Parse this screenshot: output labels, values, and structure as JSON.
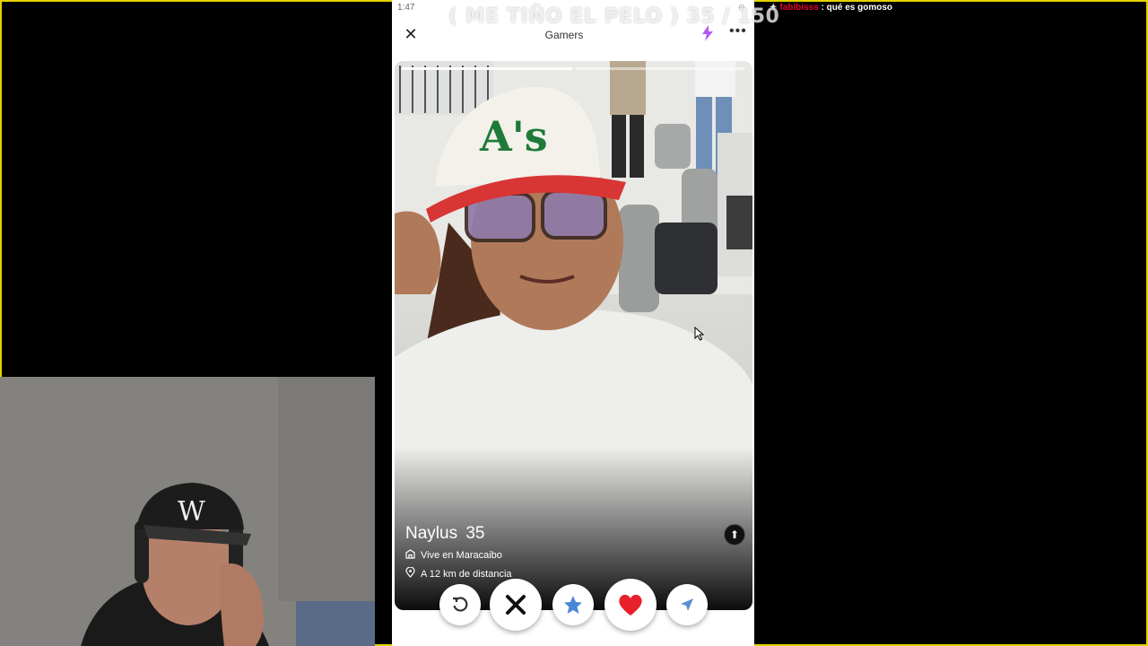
{
  "status": {
    "time": "1:47"
  },
  "app": {
    "title": "Gamers",
    "close_icon": "close-icon",
    "boost_icon": "lightning-icon",
    "more_icon": "more-icon"
  },
  "profile": {
    "name": "Naylus",
    "age": "35",
    "lives_in": "Vive en Maracaibo",
    "distance": "A 12 km de distancia",
    "photo_count": 2,
    "current_photo": 1
  },
  "actions": [
    {
      "name": "rewind",
      "icon": "rewind-icon",
      "color": "#333333"
    },
    {
      "name": "nope",
      "icon": "x-icon",
      "color": "#111111"
    },
    {
      "name": "super-like",
      "icon": "star-icon",
      "color": "#4a86d8"
    },
    {
      "name": "like",
      "icon": "heart-icon",
      "color": "#e8202a"
    },
    {
      "name": "boost",
      "icon": "send-icon",
      "color": "#5b8fd4"
    }
  ],
  "overlay": {
    "title": "( ME TIÑO EL PELO ) 35 / 150"
  },
  "chat": {
    "username": "fabibisss",
    "message": ": qué es gomoso"
  },
  "colors": {
    "frame": "#e4d300",
    "chat_user": "#e9002a",
    "like": "#e8202a",
    "star": "#4a86d8"
  }
}
